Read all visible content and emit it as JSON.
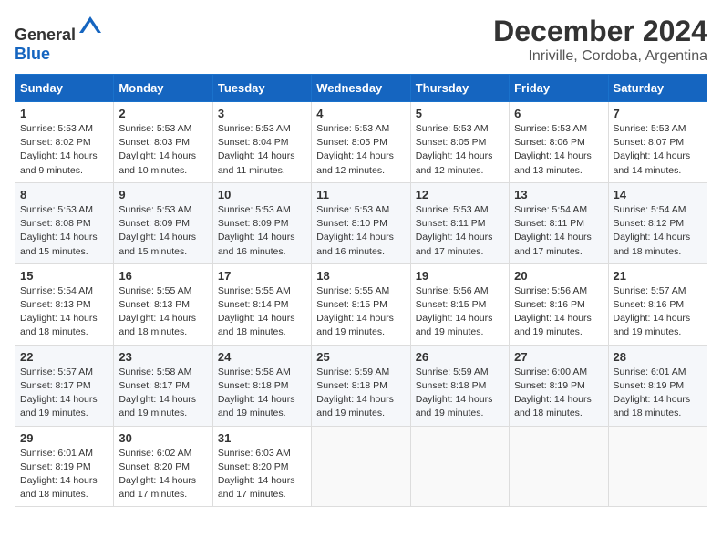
{
  "header": {
    "logo_general": "General",
    "logo_blue": "Blue",
    "title": "December 2024",
    "subtitle": "Inriville, Cordoba, Argentina"
  },
  "calendar": {
    "days_of_week": [
      "Sunday",
      "Monday",
      "Tuesday",
      "Wednesday",
      "Thursday",
      "Friday",
      "Saturday"
    ],
    "weeks": [
      [
        {
          "day": "1",
          "sunrise": "5:53 AM",
          "sunset": "8:02 PM",
          "daylight": "14 hours and 9 minutes."
        },
        {
          "day": "2",
          "sunrise": "5:53 AM",
          "sunset": "8:03 PM",
          "daylight": "14 hours and 10 minutes."
        },
        {
          "day": "3",
          "sunrise": "5:53 AM",
          "sunset": "8:04 PM",
          "daylight": "14 hours and 11 minutes."
        },
        {
          "day": "4",
          "sunrise": "5:53 AM",
          "sunset": "8:05 PM",
          "daylight": "14 hours and 12 minutes."
        },
        {
          "day": "5",
          "sunrise": "5:53 AM",
          "sunset": "8:05 PM",
          "daylight": "14 hours and 12 minutes."
        },
        {
          "day": "6",
          "sunrise": "5:53 AM",
          "sunset": "8:06 PM",
          "daylight": "14 hours and 13 minutes."
        },
        {
          "day": "7",
          "sunrise": "5:53 AM",
          "sunset": "8:07 PM",
          "daylight": "14 hours and 14 minutes."
        }
      ],
      [
        {
          "day": "8",
          "sunrise": "5:53 AM",
          "sunset": "8:08 PM",
          "daylight": "14 hours and 15 minutes."
        },
        {
          "day": "9",
          "sunrise": "5:53 AM",
          "sunset": "8:09 PM",
          "daylight": "14 hours and 15 minutes."
        },
        {
          "day": "10",
          "sunrise": "5:53 AM",
          "sunset": "8:09 PM",
          "daylight": "14 hours and 16 minutes."
        },
        {
          "day": "11",
          "sunrise": "5:53 AM",
          "sunset": "8:10 PM",
          "daylight": "14 hours and 16 minutes."
        },
        {
          "day": "12",
          "sunrise": "5:53 AM",
          "sunset": "8:11 PM",
          "daylight": "14 hours and 17 minutes."
        },
        {
          "day": "13",
          "sunrise": "5:54 AM",
          "sunset": "8:11 PM",
          "daylight": "14 hours and 17 minutes."
        },
        {
          "day": "14",
          "sunrise": "5:54 AM",
          "sunset": "8:12 PM",
          "daylight": "14 hours and 18 minutes."
        }
      ],
      [
        {
          "day": "15",
          "sunrise": "5:54 AM",
          "sunset": "8:13 PM",
          "daylight": "14 hours and 18 minutes."
        },
        {
          "day": "16",
          "sunrise": "5:55 AM",
          "sunset": "8:13 PM",
          "daylight": "14 hours and 18 minutes."
        },
        {
          "day": "17",
          "sunrise": "5:55 AM",
          "sunset": "8:14 PM",
          "daylight": "14 hours and 18 minutes."
        },
        {
          "day": "18",
          "sunrise": "5:55 AM",
          "sunset": "8:15 PM",
          "daylight": "14 hours and 19 minutes."
        },
        {
          "day": "19",
          "sunrise": "5:56 AM",
          "sunset": "8:15 PM",
          "daylight": "14 hours and 19 minutes."
        },
        {
          "day": "20",
          "sunrise": "5:56 AM",
          "sunset": "8:16 PM",
          "daylight": "14 hours and 19 minutes."
        },
        {
          "day": "21",
          "sunrise": "5:57 AM",
          "sunset": "8:16 PM",
          "daylight": "14 hours and 19 minutes."
        }
      ],
      [
        {
          "day": "22",
          "sunrise": "5:57 AM",
          "sunset": "8:17 PM",
          "daylight": "14 hours and 19 minutes."
        },
        {
          "day": "23",
          "sunrise": "5:58 AM",
          "sunset": "8:17 PM",
          "daylight": "14 hours and 19 minutes."
        },
        {
          "day": "24",
          "sunrise": "5:58 AM",
          "sunset": "8:18 PM",
          "daylight": "14 hours and 19 minutes."
        },
        {
          "day": "25",
          "sunrise": "5:59 AM",
          "sunset": "8:18 PM",
          "daylight": "14 hours and 19 minutes."
        },
        {
          "day": "26",
          "sunrise": "5:59 AM",
          "sunset": "8:18 PM",
          "daylight": "14 hours and 19 minutes."
        },
        {
          "day": "27",
          "sunrise": "6:00 AM",
          "sunset": "8:19 PM",
          "daylight": "14 hours and 18 minutes."
        },
        {
          "day": "28",
          "sunrise": "6:01 AM",
          "sunset": "8:19 PM",
          "daylight": "14 hours and 18 minutes."
        }
      ],
      [
        {
          "day": "29",
          "sunrise": "6:01 AM",
          "sunset": "8:19 PM",
          "daylight": "14 hours and 18 minutes."
        },
        {
          "day": "30",
          "sunrise": "6:02 AM",
          "sunset": "8:20 PM",
          "daylight": "14 hours and 17 minutes."
        },
        {
          "day": "31",
          "sunrise": "6:03 AM",
          "sunset": "8:20 PM",
          "daylight": "14 hours and 17 minutes."
        },
        null,
        null,
        null,
        null
      ]
    ],
    "sunrise_label": "Sunrise:",
    "sunset_label": "Sunset:",
    "daylight_label": "Daylight:"
  }
}
